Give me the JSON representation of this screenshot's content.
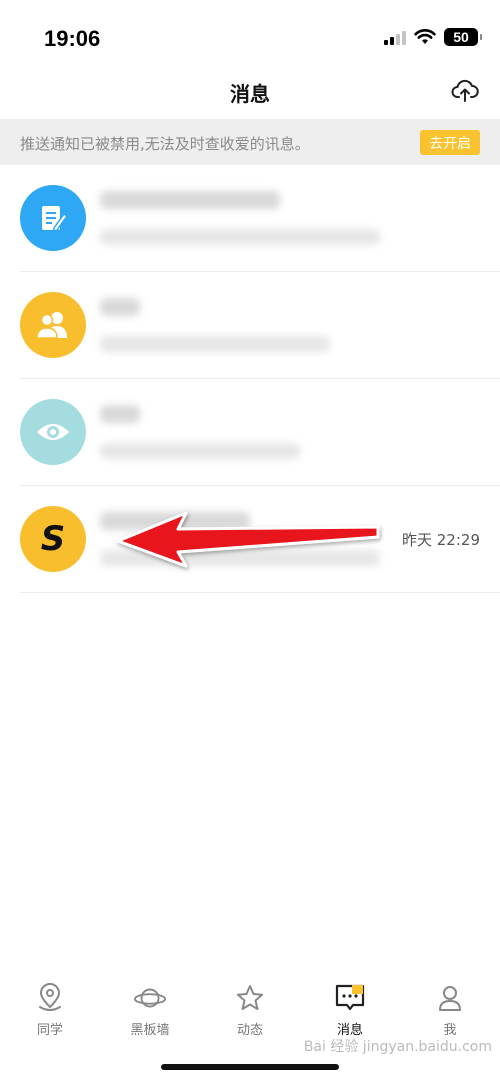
{
  "status_bar": {
    "time": "19:06",
    "battery": "50"
  },
  "nav": {
    "title": "消息"
  },
  "notice": {
    "text": "推送通知已被禁用,无法及时查收爱的讯息。",
    "button": "去开启"
  },
  "messages": [
    {
      "avatar_icon": "note-edit-icon",
      "avatar_color": "#2ea8f5"
    },
    {
      "avatar_icon": "group-icon",
      "avatar_color": "#f8be2e"
    },
    {
      "avatar_icon": "eye-icon",
      "avatar_color": "#a4dce0"
    },
    {
      "avatar_icon": "letter-s-icon",
      "avatar_letter": "S",
      "avatar_color": "#f8be2e",
      "time": "昨天 22:29"
    }
  ],
  "tabs": [
    {
      "label": "同学",
      "icon": "location-pin-icon"
    },
    {
      "label": "黑板墙",
      "icon": "planet-icon"
    },
    {
      "label": "动态",
      "icon": "star-icon"
    },
    {
      "label": "消息",
      "icon": "chat-bubble-icon",
      "active": true
    },
    {
      "label": "我",
      "icon": "person-icon"
    }
  ],
  "annotation": {
    "arrow_color": "#e8141b"
  },
  "watermark": "Bai 经验 jingyan.baidu.com"
}
